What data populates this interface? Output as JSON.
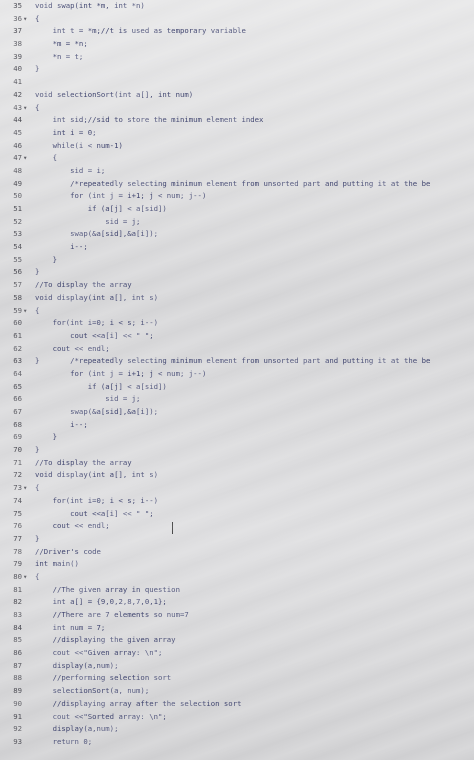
{
  "editor": {
    "lines": [
      {
        "num": "35",
        "fold": "",
        "code": "void swap(int *m, int *n)"
      },
      {
        "num": "36",
        "fold": "▾",
        "code": "{"
      },
      {
        "num": "37",
        "fold": "",
        "code": "    int t = *m;//t is used as temporary variable"
      },
      {
        "num": "38",
        "fold": "",
        "code": "    *m = *n;"
      },
      {
        "num": "39",
        "fold": "",
        "code": "    *n = t;"
      },
      {
        "num": "40",
        "fold": "",
        "code": "}"
      },
      {
        "num": "41",
        "fold": "",
        "code": ""
      },
      {
        "num": "42",
        "fold": "",
        "code": "void selectionSort(int a[], int num)"
      },
      {
        "num": "43",
        "fold": "▾",
        "code": "{"
      },
      {
        "num": "44",
        "fold": "",
        "code": "    int sid;//sid to store the minimum element index"
      },
      {
        "num": "45",
        "fold": "",
        "code": "    int i = 0;"
      },
      {
        "num": "46",
        "fold": "",
        "code": "    while(i < num-1)"
      },
      {
        "num": "47",
        "fold": "▾",
        "code": "    {"
      },
      {
        "num": "48",
        "fold": "",
        "code": "        sid = i;"
      },
      {
        "num": "49",
        "fold": "",
        "code": "        /*repeatedly selecting minimum element from unsorted part and putting it at the be"
      },
      {
        "num": "50",
        "fold": "",
        "code": "        for (int j = i+1; j < num; j--)"
      },
      {
        "num": "51",
        "fold": "",
        "code": "            if (a[j] < a[sid])"
      },
      {
        "num": "52",
        "fold": "",
        "code": "                sid = j;"
      },
      {
        "num": "53",
        "fold": "",
        "code": "        swap(&a[sid],&a[i]);"
      },
      {
        "num": "54",
        "fold": "",
        "code": "        i--;"
      },
      {
        "num": "55",
        "fold": "",
        "code": "    }"
      },
      {
        "num": "56",
        "fold": "",
        "code": "}"
      },
      {
        "num": "57",
        "fold": "",
        "code": "//To display the array"
      },
      {
        "num": "58",
        "fold": "",
        "code": "void display(int a[], int s)"
      },
      {
        "num": "59",
        "fold": "▾",
        "code": "{"
      },
      {
        "num": "60",
        "fold": "",
        "code": "    for(int i=0; i < s; i--)"
      },
      {
        "num": "61",
        "fold": "",
        "code": "        cout <<a[i] << \" \";"
      },
      {
        "num": "62",
        "fold": "",
        "code": "    cout << endl;"
      },
      {
        "num": "63",
        "fold": "",
        "code": "}       /*repeatedly selecting minimum element from unsorted part and putting it at the be"
      },
      {
        "num": "64",
        "fold": "",
        "code": "        for (int j = i+1; j < num; j--)"
      },
      {
        "num": "65",
        "fold": "",
        "code": "            if (a[j] < a[sid])"
      },
      {
        "num": "66",
        "fold": "",
        "code": "                sid = j;"
      },
      {
        "num": "67",
        "fold": "",
        "code": "        swap(&a[sid],&a[i]);"
      },
      {
        "num": "68",
        "fold": "",
        "code": "        i--;"
      },
      {
        "num": "69",
        "fold": "",
        "code": "    }"
      },
      {
        "num": "70",
        "fold": "",
        "code": "}"
      },
      {
        "num": "71",
        "fold": "",
        "code": "//To display the array"
      },
      {
        "num": "72",
        "fold": "",
        "code": "void display(int a[], int s)"
      },
      {
        "num": "73",
        "fold": "▾",
        "code": "{"
      },
      {
        "num": "74",
        "fold": "",
        "code": "    for(int i=0; i < s; i--)"
      },
      {
        "num": "75",
        "fold": "",
        "code": "        cout <<a[i] << \" \";"
      },
      {
        "num": "76",
        "fold": "",
        "code": "    cout << endl;"
      },
      {
        "num": "77",
        "fold": "",
        "code": "}"
      },
      {
        "num": "78",
        "fold": "",
        "code": "//Driver's code"
      },
      {
        "num": "79",
        "fold": "",
        "code": "int main()"
      },
      {
        "num": "80",
        "fold": "▾",
        "code": "{"
      },
      {
        "num": "81",
        "fold": "",
        "code": "    //The given array in question"
      },
      {
        "num": "82",
        "fold": "",
        "code": "    int a[] = {9,0,2,8,7,0,1};"
      },
      {
        "num": "83",
        "fold": "",
        "code": "    //There are 7 elements so num=7"
      },
      {
        "num": "84",
        "fold": "",
        "code": "    int num = 7;"
      },
      {
        "num": "85",
        "fold": "",
        "code": "    //displaying the given array"
      },
      {
        "num": "86",
        "fold": "",
        "code": "    cout <<\"Given array: \\n\";"
      },
      {
        "num": "87",
        "fold": "",
        "code": "    display(a,num);"
      },
      {
        "num": "88",
        "fold": "",
        "code": "    //performing selection sort"
      },
      {
        "num": "89",
        "fold": "",
        "code": "    selectionSort(a, num);"
      },
      {
        "num": "90",
        "fold": "",
        "code": "    //displaying array after the selection sort"
      },
      {
        "num": "91",
        "fold": "",
        "code": "    cout <<\"Sorted array: \\n\";"
      },
      {
        "num": "92",
        "fold": "",
        "code": "    display(a,num);"
      },
      {
        "num": "93",
        "fold": "",
        "code": "    return 0;"
      }
    ]
  }
}
